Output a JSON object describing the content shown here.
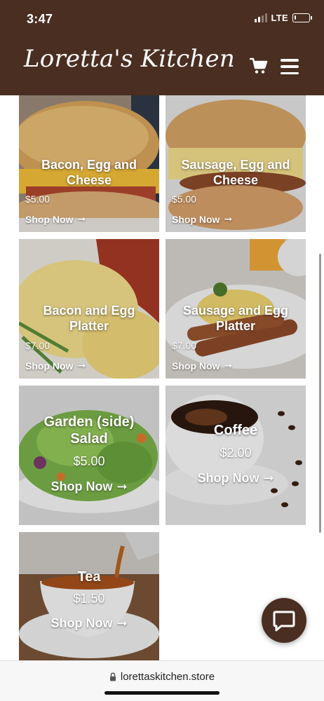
{
  "status_bar": {
    "time": "3:47",
    "network": "LTE",
    "signal_bars": 2,
    "signal_bars_total": 4,
    "battery_level": 0.12
  },
  "header": {
    "brand": "Loretta's Kitchen",
    "cart_icon": "cart-icon",
    "menu_icon": "hamburger-menu-icon",
    "background_color": "#4a2e22"
  },
  "products": [
    {
      "name": "Bacon, Egg and Cheese",
      "price": "$5.00",
      "cta": "Shop Now",
      "icon": "arrow-right-icon"
    },
    {
      "name": "Sausage, Egg and Cheese",
      "price": "$5.00",
      "cta": "Shop Now",
      "icon": "arrow-right-icon"
    },
    {
      "name": "Bacon and Egg Platter",
      "price": "$7.00",
      "cta": "Shop Now",
      "icon": "arrow-right-icon"
    },
    {
      "name": "Sausage and Egg Platter",
      "price": "$7.00",
      "cta": "Shop Now",
      "icon": "arrow-right-icon"
    },
    {
      "name": "Garden (side) Salad",
      "price": "$5.00",
      "cta": "Shop Now",
      "icon": "arrow-right-icon"
    },
    {
      "name": "Coffee",
      "price": "$2.00",
      "cta": "Shop Now",
      "icon": "arrow-right-icon"
    },
    {
      "name": "Tea",
      "price": "$1.50",
      "cta": "Shop Now",
      "icon": "arrow-right-icon"
    }
  ],
  "chat": {
    "icon": "chat-bubble-icon"
  },
  "browser": {
    "url": "lorettaskitchen.store",
    "lock_icon": "lock-icon"
  }
}
